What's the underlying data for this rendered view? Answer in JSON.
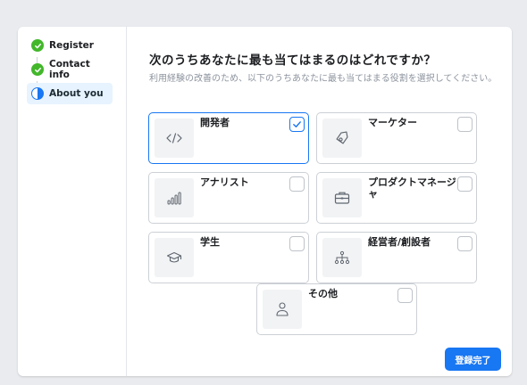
{
  "steps": [
    {
      "label": "Register",
      "status": "done"
    },
    {
      "label": "Contact info",
      "status": "done"
    },
    {
      "label": "About you",
      "status": "active"
    }
  ],
  "heading": "次のうちあなたに最も当てはまるのはどれですか？",
  "subheading": "利用経験の改善のため、以下のうちあなたに最も当てはまる役割を選択してください。",
  "options": [
    {
      "label": "開発者",
      "icon": "code-icon",
      "selected": true
    },
    {
      "label": "マーケター",
      "icon": "tag-icon",
      "selected": false
    },
    {
      "label": "アナリスト",
      "icon": "bar-chart-icon",
      "selected": false
    },
    {
      "label": "プロダクトマネージャ",
      "icon": "briefcase-icon",
      "selected": false
    },
    {
      "label": "学生",
      "icon": "graduation-cap-icon",
      "selected": false
    },
    {
      "label": "経営者/創設者",
      "icon": "org-chart-icon",
      "selected": false
    },
    {
      "label": "その他",
      "icon": "person-icon",
      "selected": false
    }
  ],
  "submit_label": "登録完了",
  "colors": {
    "accent": "#1877f2",
    "done": "#42b72a"
  }
}
